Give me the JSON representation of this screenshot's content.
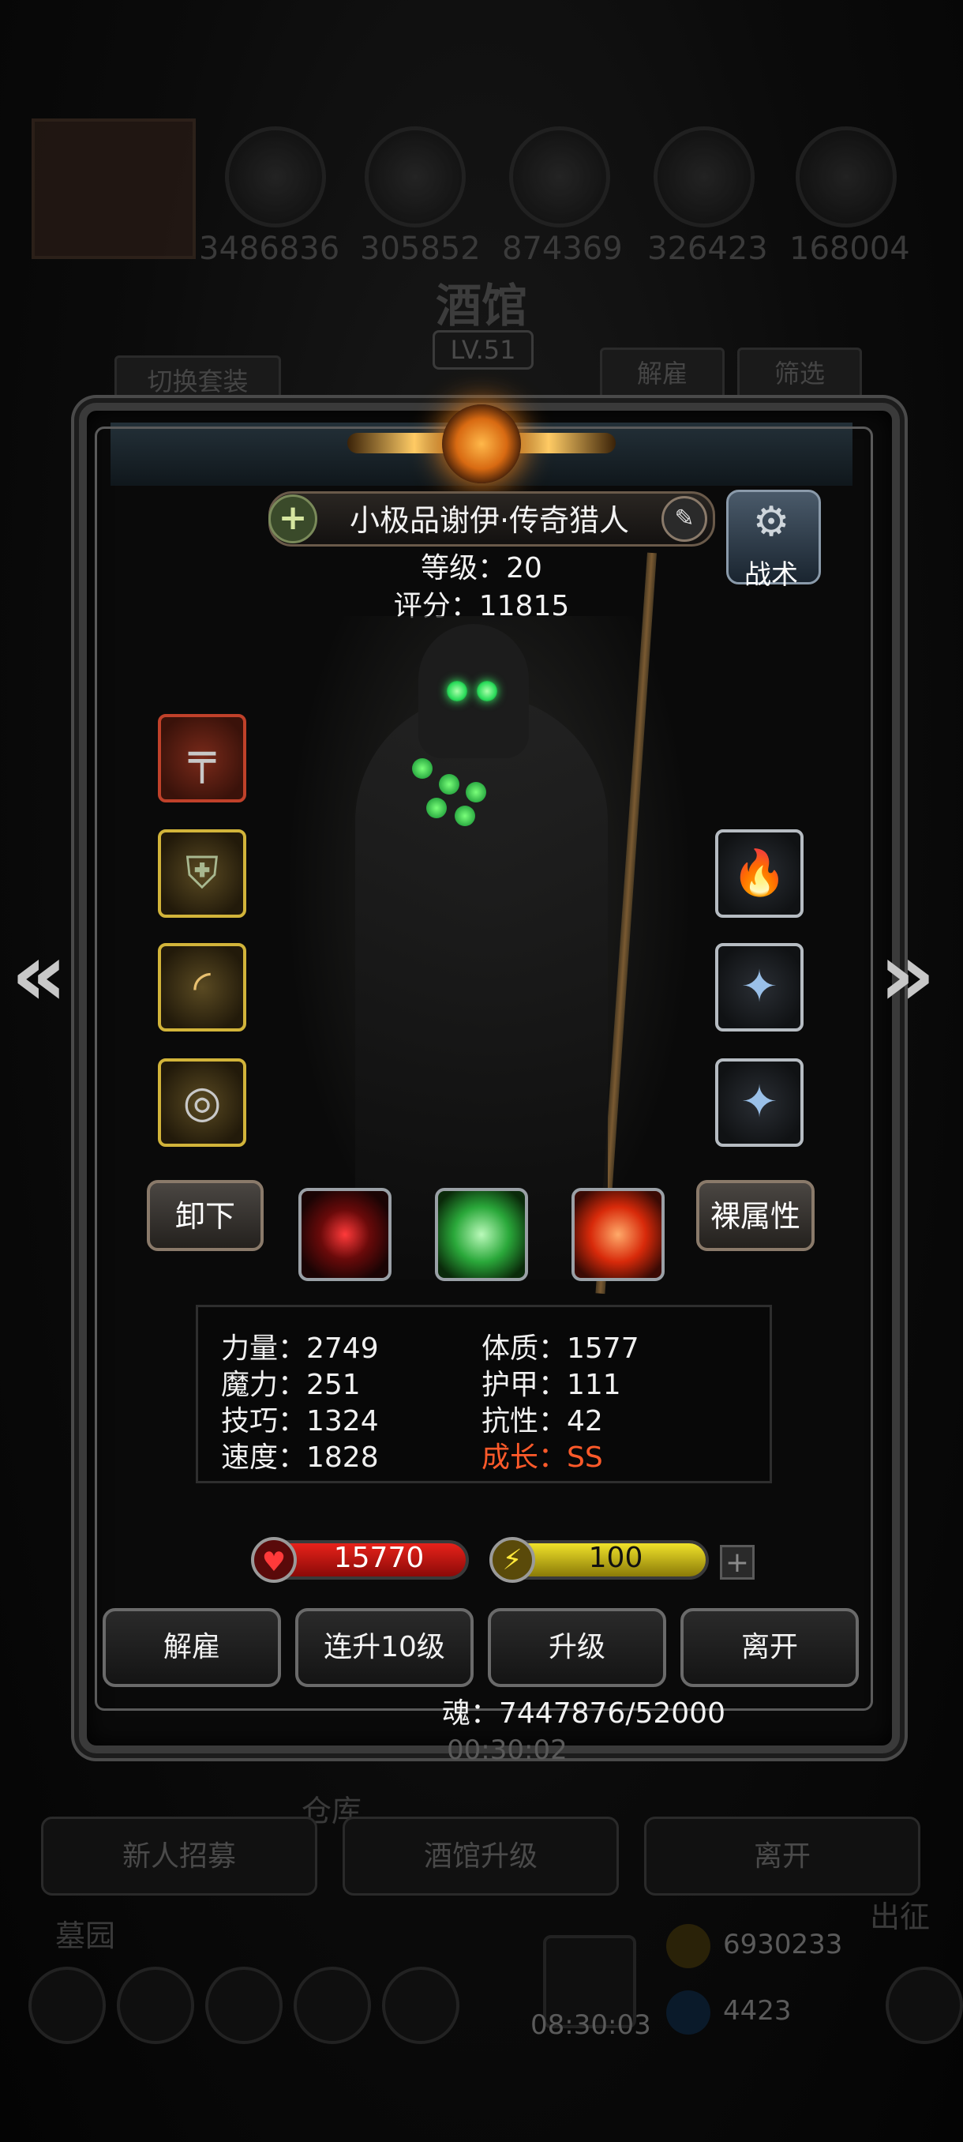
{
  "background": {
    "resources": [
      "3486836",
      "305852",
      "874369",
      "326423",
      "168004"
    ],
    "building_title": "酒馆",
    "building_level": "LV.51",
    "switch_outfit": "切换套装",
    "dismiss_tab": "解雇",
    "filter_tab": "筛选",
    "tavern_timer": "00:30:02",
    "warehouse_label": "仓库",
    "recruit_button": "新人招募",
    "upgrade_tavern_button": "酒馆升级",
    "leave_button": "离开",
    "graveyard_label": "墓园",
    "expedition_label": "出征",
    "bottom_timer": "08:30:03",
    "gold_amount": "6930233",
    "gem_amount": "4423"
  },
  "hero": {
    "name": "小极品谢伊·传奇猎人",
    "level_text": "等级：20",
    "score_text": "评分：11815",
    "tactics_label": "战术"
  },
  "equipment": {
    "left_slots": [
      {
        "name": "revolver-icon",
        "rarity": "red"
      },
      {
        "name": "armor-icon",
        "rarity": "gold"
      },
      {
        "name": "horn-icon",
        "rarity": "gold"
      },
      {
        "name": "ring-icon",
        "rarity": "gold"
      }
    ],
    "right_slots": [
      {
        "name": "fire-rune-icon",
        "rarity": "silver"
      },
      {
        "name": "crystal-badge-icon",
        "rarity": "silver"
      },
      {
        "name": "crystal-badge-icon",
        "rarity": "silver"
      }
    ],
    "unequip_button": "卸下",
    "base_attr_button": "裸属性"
  },
  "skills": [
    {
      "name": "crosshair-skill-icon",
      "color": "#c8161e"
    },
    {
      "name": "poison-skull-skill-icon",
      "color": "#3ac83a"
    },
    {
      "name": "heal-cross-skill-icon",
      "color": "#e8261a"
    }
  ],
  "attributes": {
    "strength": "力量：2749",
    "magic": "魔力：251",
    "skill": "技巧：1324",
    "speed": "速度：1828",
    "constitution": "体质：1577",
    "armor": "护甲：111",
    "resistance": "抗性：42",
    "growth": "成长：SS"
  },
  "bars": {
    "hp": "15770",
    "energy": "100"
  },
  "actions": {
    "dismiss": "解雇",
    "level_up_10": "连升10级",
    "level_up": "升级",
    "leave": "离开"
  },
  "soul_text": "魂：7447876/52000",
  "colors": {
    "growth_text": "#ff5a2a",
    "hp_bar": "#e8221a",
    "energy_bar": "#f0e22a"
  }
}
